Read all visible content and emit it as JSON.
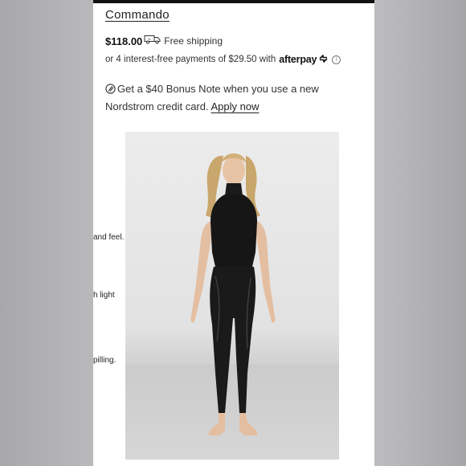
{
  "product": {
    "brand": "Commando",
    "price": "$118.00",
    "shipping": "Free shipping"
  },
  "payments": {
    "text": "or 4 interest-free payments of $29.50 with",
    "provider": "afterpay",
    "info_icon": "info-icon"
  },
  "promo": {
    "text": "Get a $40 Bonus Note when you use a new Nordstrom credit card.",
    "link": "Apply now",
    "icon": "note-icon"
  },
  "description_fragments": [
    "and feel.",
    "h light",
    "pilling."
  ],
  "image": {
    "alt": "Model wearing black sleeveless mock-neck bodysuit and faux leather leggings",
    "icon": "product-photo"
  }
}
